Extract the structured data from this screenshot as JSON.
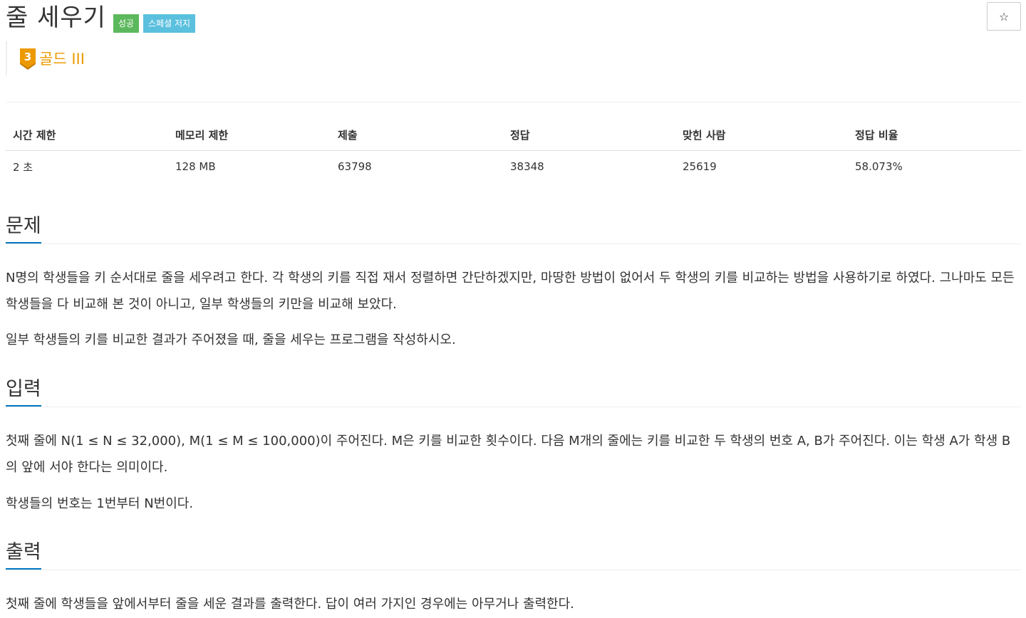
{
  "problem": {
    "title": "줄 세우기",
    "labels": [
      "성공",
      "스페셜 저지"
    ],
    "star_icon": "☆",
    "tier": {
      "badge_number": "3",
      "name": "골드 III",
      "color": "#ec9a00"
    }
  },
  "info_table": {
    "headers": [
      "시간 제한",
      "메모리 제한",
      "제출",
      "정답",
      "맞힌 사람",
      "정답 비율"
    ],
    "values": [
      "2 초",
      "128 MB",
      "63798",
      "38348",
      "25619",
      "58.073%"
    ]
  },
  "sections": {
    "description": {
      "heading": "문제",
      "paragraphs": [
        "N명의 학생들을 키 순서대로 줄을 세우려고 한다. 각 학생의 키를 직접 재서 정렬하면 간단하겠지만, 마땅한 방법이 없어서 두 학생의 키를 비교하는 방법을 사용하기로 하였다. 그나마도 모든 학생들을 다 비교해 본 것이 아니고, 일부 학생들의 키만을 비교해 보았다.",
        "일부 학생들의 키를 비교한 결과가 주어졌을 때, 줄을 세우는 프로그램을 작성하시오."
      ]
    },
    "input": {
      "heading": "입력",
      "paragraphs": [
        "첫째 줄에 N(1 ≤ N ≤ 32,000), M(1 ≤ M ≤ 100,000)이 주어진다. M은 키를 비교한 횟수이다. 다음 M개의 줄에는 키를 비교한 두 학생의 번호 A, B가 주어진다. 이는 학생 A가 학생 B의 앞에 서야 한다는 의미이다.",
        "학생들의 번호는 1번부터 N번이다."
      ]
    },
    "output": {
      "heading": "출력",
      "paragraphs": [
        "첫째 줄에 학생들을 앞에서부터 줄을 세운 결과를 출력한다. 답이 여러 가지인 경우에는 아무거나 출력한다."
      ]
    }
  },
  "colors": {
    "success_label": "#5cb85c",
    "info_label": "#5bc0de",
    "section_underline": "#0076c0"
  }
}
